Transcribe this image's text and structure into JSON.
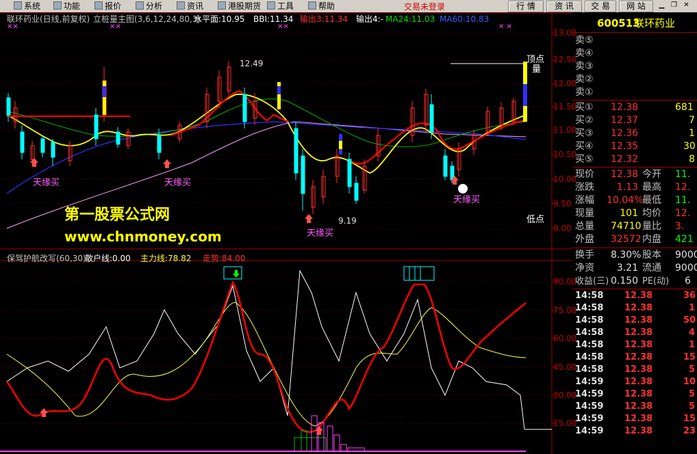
{
  "menu": {
    "items": [
      "系统",
      "功能",
      "报价",
      "分析",
      "资讯",
      "港股期货",
      "工具",
      "帮助"
    ],
    "login_status": "交易未登录",
    "buttons": [
      "行 情",
      "资 讯",
      "交 易",
      "网 站"
    ]
  },
  "header": {
    "stock": "联环药业(日线,前复权)",
    "indicator": "立桩量主图(3,6,12,24,80,3)",
    "level": "水平面:10.95",
    "bbi": "BBI:11.34",
    "out3": "输出3:11.34",
    "out4": "输出4:-",
    "ma24": "MA24:11.03",
    "ma60": "MA60:10.83"
  },
  "price_axis": [
    "13.00",
    "12.50",
    "12.00",
    "11.50",
    "11.00",
    "10.50",
    "10.00",
    "9.50",
    "9.00"
  ],
  "chart_labels": {
    "high_value": "12.49",
    "low_value": "9.19",
    "buy1": "天缘买",
    "buy2": "天缘买",
    "buy3": "天缘买",
    "buy4": "天缘买",
    "top_point": "顶点",
    "low_point": "低点",
    "side_mark": "量"
  },
  "watermark": {
    "name": "第一股票公式网",
    "url": "www.chnmoney.com"
  },
  "lower_header": {
    "indicator": "保驾护航改写(60,30)",
    "retail": "散户线:0.00",
    "main": "主力线:78.82",
    "trend": "走势:84.00"
  },
  "indicator_axis": [
    "90.00",
    "75.00",
    "60.00",
    "45.00",
    "30.00",
    "15.00"
  ],
  "quote": {
    "code": "600513",
    "name": "联环药业",
    "sell": [
      {
        "label": "卖⑤",
        "price": "",
        "vol": ""
      },
      {
        "label": "卖④",
        "price": "",
        "vol": ""
      },
      {
        "label": "卖③",
        "price": "",
        "vol": ""
      },
      {
        "label": "卖②",
        "price": "",
        "vol": ""
      },
      {
        "label": "卖①",
        "price": "",
        "vol": ""
      }
    ],
    "buy": [
      {
        "label": "买①",
        "price": "12.38",
        "vol": "681"
      },
      {
        "label": "买②",
        "price": "12.37",
        "vol": "7"
      },
      {
        "label": "买③",
        "price": "12.36",
        "vol": "1"
      },
      {
        "label": "买④",
        "price": "12.35",
        "vol": "30"
      },
      {
        "label": "买⑤",
        "price": "12.32",
        "vol": "8"
      }
    ],
    "stats1": [
      {
        "l1": "现价",
        "v1": "12.38",
        "l2": "今开",
        "v2": "11."
      },
      {
        "l1": "涨跌",
        "v1": "1.13",
        "l2": "最高",
        "v2": "12."
      },
      {
        "l1": "涨幅",
        "v1": "10.04%",
        "l2": "最低",
        "v2": "11."
      },
      {
        "l1": "现量",
        "v1": "101",
        "l2": "均价",
        "v2": "12."
      },
      {
        "l1": "总量",
        "v1": "74710",
        "l2": "量比",
        "v2": "3."
      },
      {
        "l1": "外盘",
        "v1": "32572",
        "l2": "内盘",
        "v2": "421"
      }
    ],
    "stats2": [
      {
        "l1": "换手",
        "v1": "8.30%",
        "l2": "股本",
        "v2": "9000"
      },
      {
        "l1": "净资",
        "v1": "3.21",
        "l2": "流通",
        "v2": "9000"
      },
      {
        "l1": "收益(三)",
        "v1": "0.150",
        "l2": "PE(动)",
        "v2": "6"
      }
    ],
    "ticks": [
      {
        "t": "14:58",
        "p": "12.38",
        "v": "36"
      },
      {
        "t": "14:58",
        "p": "12.38",
        "v": "1"
      },
      {
        "t": "14:58",
        "p": "12.38",
        "v": "50"
      },
      {
        "t": "14:58",
        "p": "12.38",
        "v": "4"
      },
      {
        "t": "14:58",
        "p": "12.38",
        "v": "1"
      },
      {
        "t": "14:58",
        "p": "12.38",
        "v": "15"
      },
      {
        "t": "14:58",
        "p": "12.38",
        "v": "5"
      },
      {
        "t": "14:59",
        "p": "12.38",
        "v": "10"
      },
      {
        "t": "14:59",
        "p": "12.38",
        "v": "5"
      },
      {
        "t": "14:59",
        "p": "12.38",
        "v": "5"
      },
      {
        "t": "14:59",
        "p": "12.38",
        "v": "15"
      },
      {
        "t": "14:59",
        "p": "12.38",
        "v": "23"
      }
    ]
  },
  "colors": {
    "up": "#ff3030",
    "down": "#00ffff",
    "ma_short": "#ffff00",
    "ma_red": "#ff0000",
    "ma_mid": "#00b000",
    "ma_long": "#3030ff",
    "ma_vlong": "#ffa0ff",
    "grid": "#a00000"
  }
}
